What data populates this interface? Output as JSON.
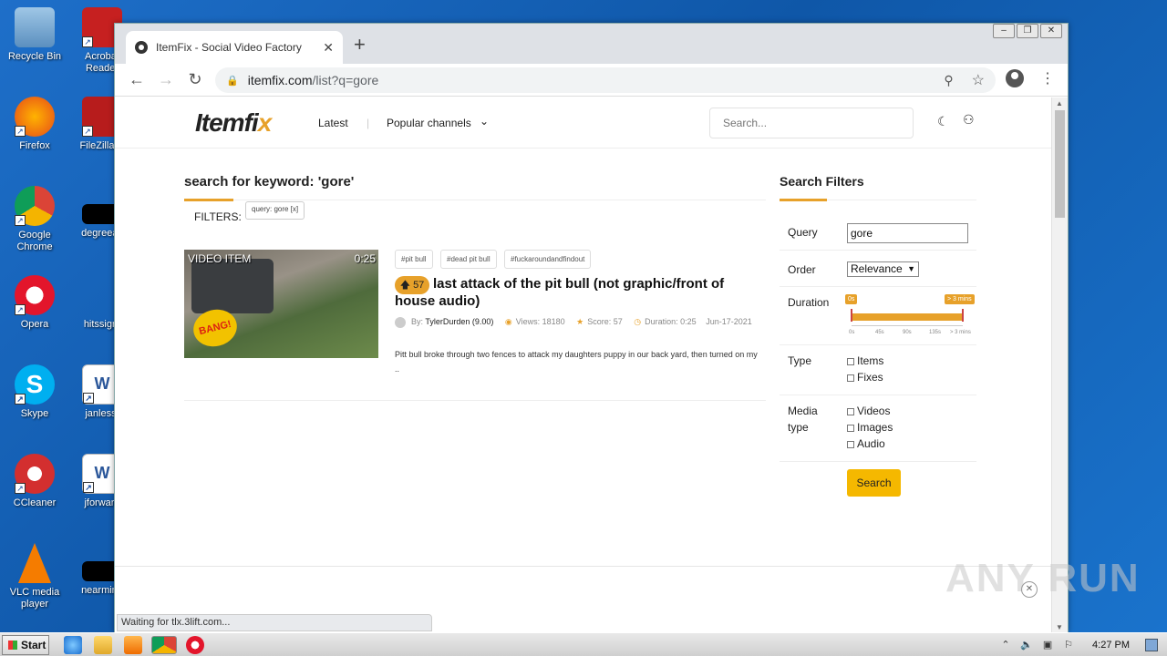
{
  "desktop": {
    "icons": [
      {
        "label": "Recycle Bin",
        "icon": "recycle-bin-icon"
      },
      {
        "label": "Acrobat Reader",
        "icon": "acrobat-icon"
      },
      {
        "label": "Firefox",
        "icon": "firefox-icon"
      },
      {
        "label": "FileZilla C",
        "icon": "filezilla-icon"
      },
      {
        "label": "Google Chrome",
        "icon": "chrome-icon"
      },
      {
        "label": "degreeac",
        "icon": "file-icon"
      },
      {
        "label": "Opera",
        "icon": "opera-icon"
      },
      {
        "label": "hitssign.",
        "icon": "file-icon"
      },
      {
        "label": "Skype",
        "icon": "skype-icon"
      },
      {
        "label": "janless.",
        "icon": "word-icon"
      },
      {
        "label": "CCleaner",
        "icon": "ccleaner-icon"
      },
      {
        "label": "jforward",
        "icon": "word-icon"
      },
      {
        "label": "VLC media player",
        "icon": "vlc-icon"
      },
      {
        "label": "nearminu",
        "icon": "file-icon"
      }
    ]
  },
  "browser": {
    "tab_title": "ItemFix - Social Video Factory",
    "url_host": "itemfix.com",
    "url_path": "/list?q=gore",
    "status": "Waiting for tlx.3lift.com..."
  },
  "site": {
    "logo": "Itemfi",
    "logo_x": "x",
    "nav_latest": "Latest",
    "nav_popular": "Popular channels",
    "search_placeholder": "Search..."
  },
  "results": {
    "heading": "search for keyword: 'gore'",
    "filters_label": "FILTERS:",
    "filter_chip": "query: gore [x]",
    "item": {
      "thumb_label": "VIDEO ITEM",
      "duration": "0:25",
      "tags": [
        "#pit bull",
        "#dead pit bull",
        "#fuckaroundandfindout"
      ],
      "votes": "57",
      "title": "last attack of the pit bull (not graphic/front of house audio)",
      "by_label": "By:",
      "author": "TylerDurden (9.00)",
      "views": "Views: 18180",
      "score": "Score: 57",
      "duration_meta": "Duration: 0:25",
      "date": "Jun-17-2021",
      "description": "Pitt bull broke through two fences to attack my daughters puppy in our back yard, then turned on my .."
    }
  },
  "filters": {
    "title": "Search Filters",
    "query_label": "Query",
    "query_value": "gore",
    "order_label": "Order",
    "order_value": "Relevance",
    "duration_label": "Duration",
    "duration_min": "0s",
    "duration_max": "> 3 mins",
    "ticks": [
      "0s",
      "45s",
      "90s",
      "135s",
      "> 3 mins"
    ],
    "type_label": "Type",
    "type_options": [
      "Items",
      "Fixes"
    ],
    "media_label_1": "Media",
    "media_label_2": "type",
    "media_options": [
      "Videos",
      "Images",
      "Audio"
    ],
    "search_button": "Search"
  },
  "watermark": "ANY RUN",
  "taskbar": {
    "start": "Start",
    "clock": "4:27 PM"
  },
  "colors": {
    "accent": "#e7a12a",
    "search_button": "#f5b800",
    "desktop": "#1565b8"
  }
}
